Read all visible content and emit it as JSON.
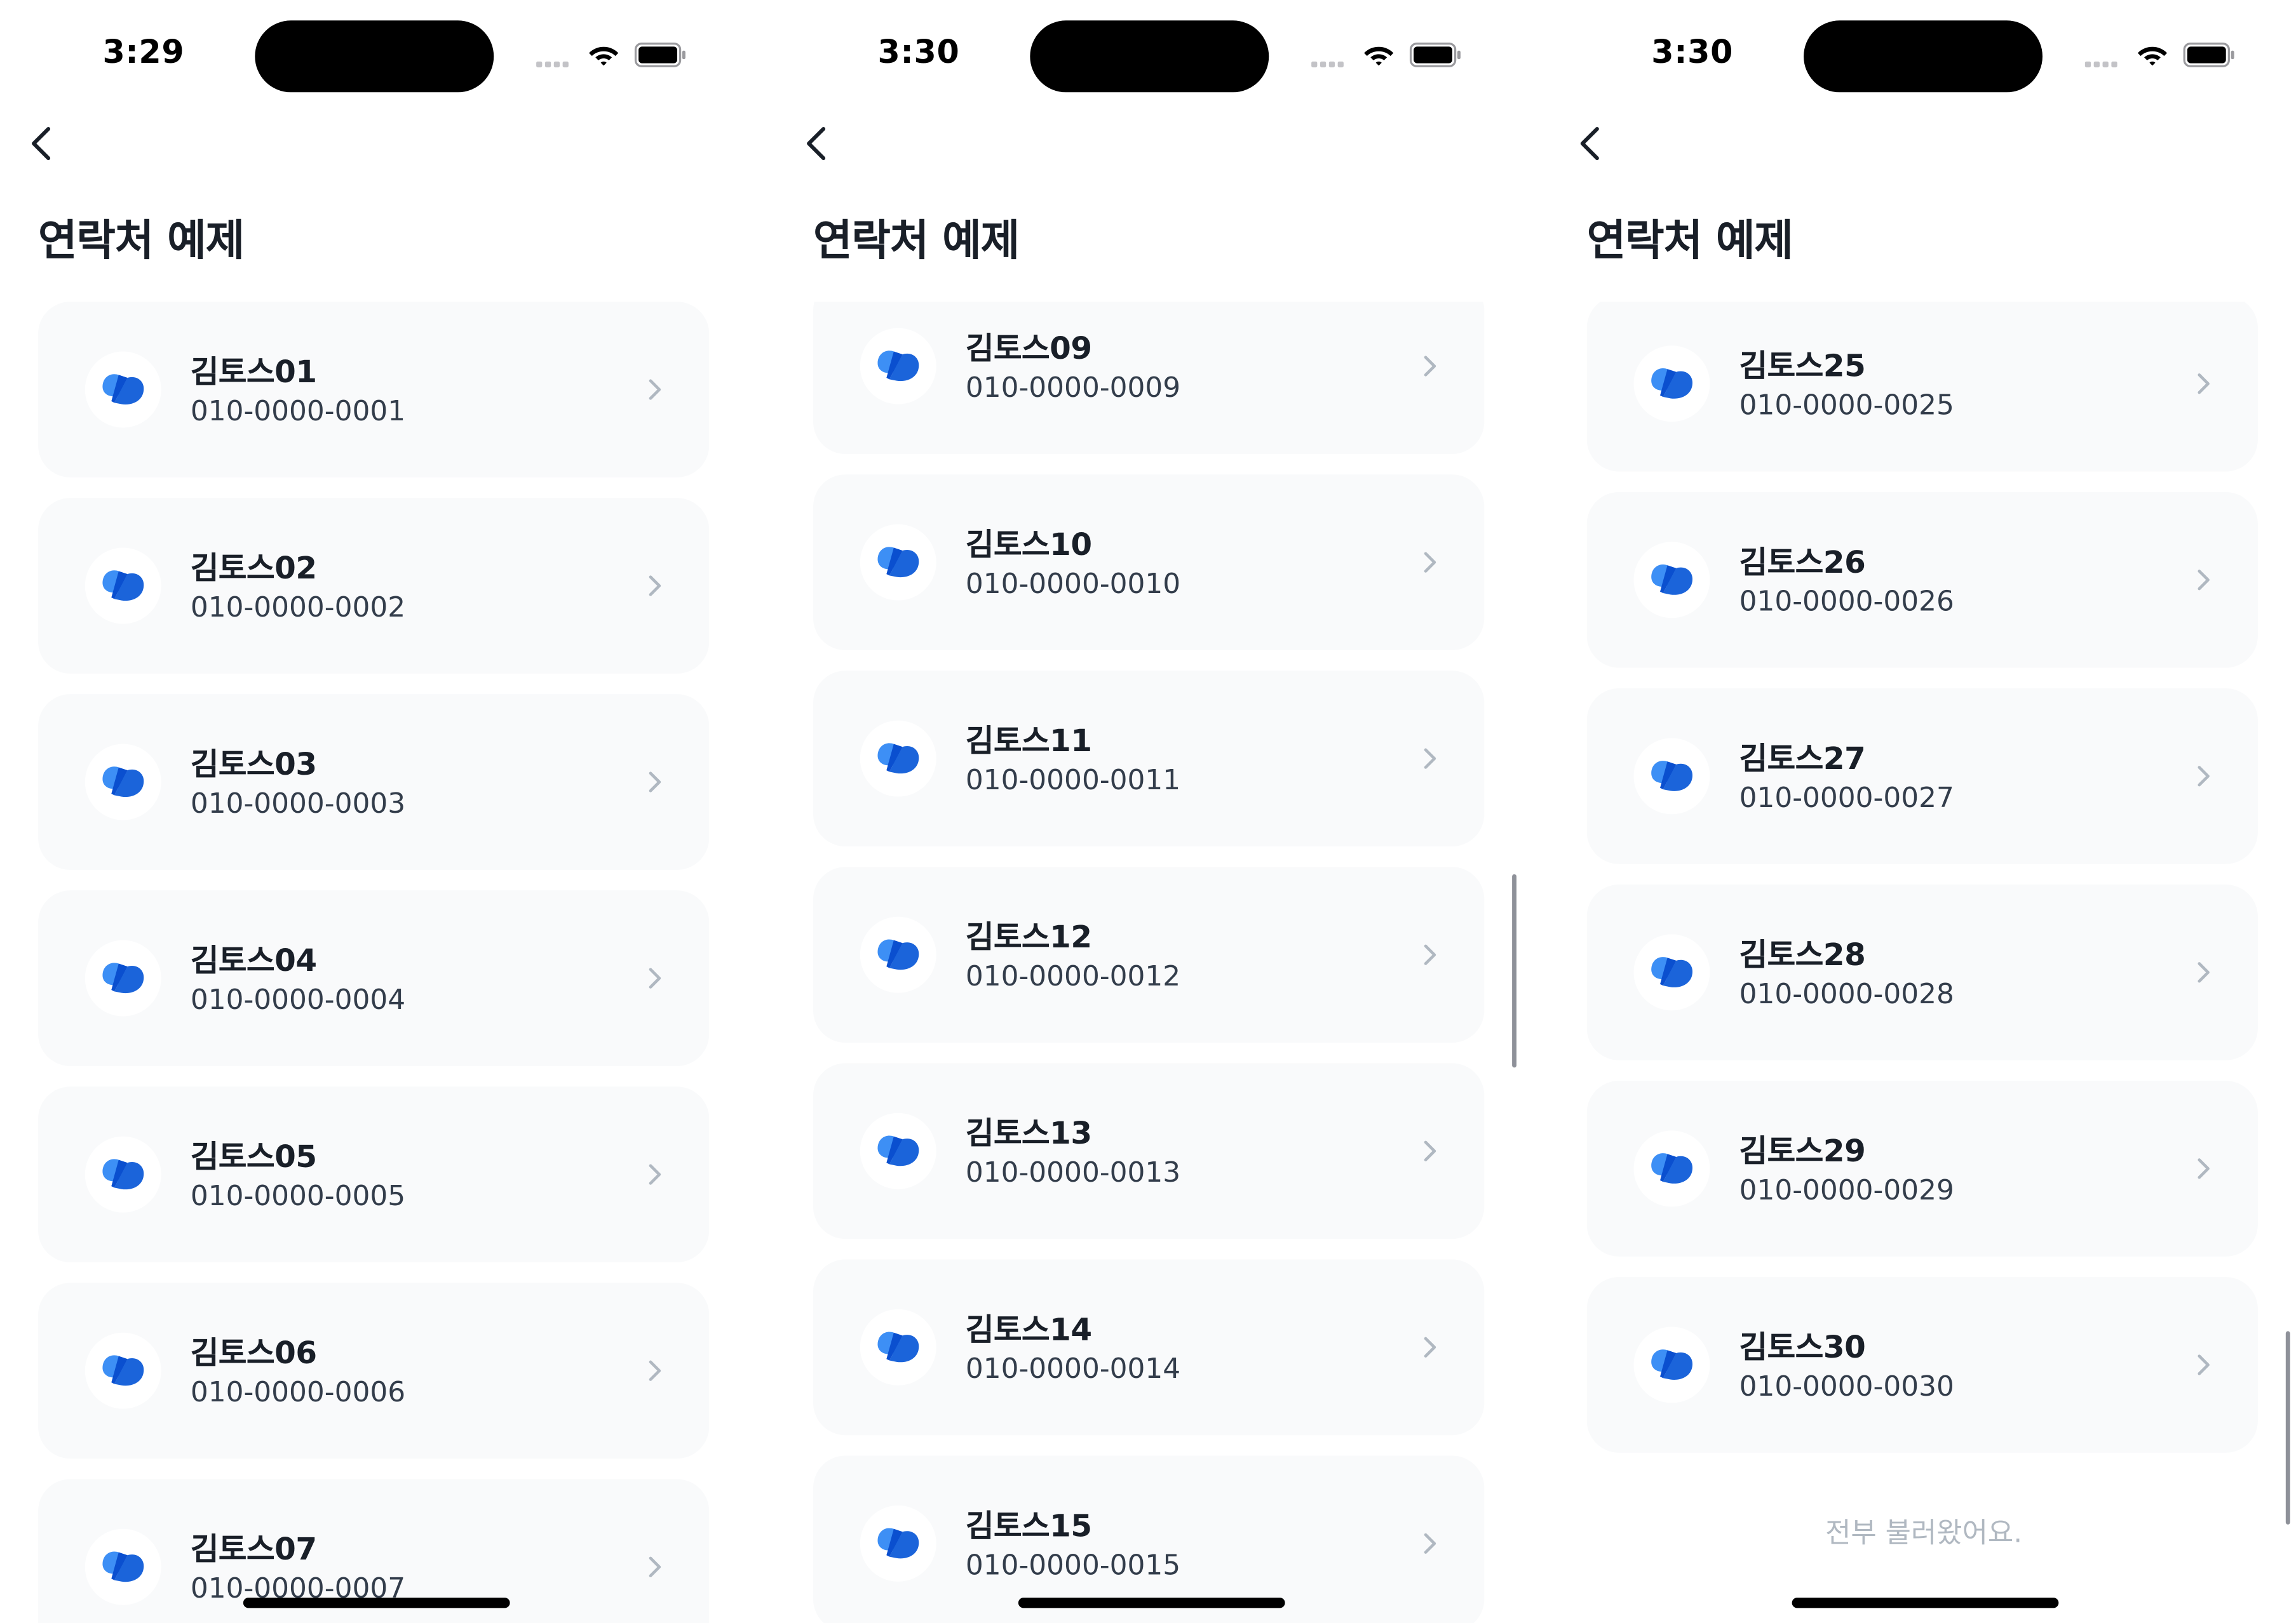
{
  "colors": {
    "background": "#ffffff",
    "card": "#f9fafb",
    "title_text": "#191f28",
    "phone_text": "#333d4b",
    "muted_text": "#b0b8c1",
    "chevron": "#b0b8c1",
    "logo_blue": "#3182f6"
  },
  "icons": {
    "back": "chevron-left-icon",
    "row_chevron": "chevron-right-icon",
    "avatar": "toss-logo-icon",
    "wifi": "wifi-icon",
    "battery": "battery-icon"
  },
  "screens": [
    {
      "status": {
        "time": "3:29"
      },
      "title": "연락처 예제",
      "contacts": [
        {
          "name": "김토스01",
          "phone": "010-0000-0001"
        },
        {
          "name": "김토스02",
          "phone": "010-0000-0002"
        },
        {
          "name": "김토스03",
          "phone": "010-0000-0003"
        },
        {
          "name": "김토스04",
          "phone": "010-0000-0004"
        },
        {
          "name": "김토스05",
          "phone": "010-0000-0005"
        },
        {
          "name": "김토스06",
          "phone": "010-0000-0006"
        },
        {
          "name": "김토스07",
          "phone": "010-0000-0007"
        }
      ],
      "end_message": ""
    },
    {
      "status": {
        "time": "3:30"
      },
      "title": "연락처 예제",
      "contacts": [
        {
          "name": "김토스09",
          "phone": "010-0000-0009"
        },
        {
          "name": "김토스10",
          "phone": "010-0000-0010"
        },
        {
          "name": "김토스11",
          "phone": "010-0000-0011"
        },
        {
          "name": "김토스12",
          "phone": "010-0000-0012"
        },
        {
          "name": "김토스13",
          "phone": "010-0000-0013"
        },
        {
          "name": "김토스14",
          "phone": "010-0000-0014"
        },
        {
          "name": "김토스15",
          "phone": "010-0000-0015"
        }
      ],
      "end_message": ""
    },
    {
      "status": {
        "time": "3:30"
      },
      "title": "연락처 예제",
      "contacts": [
        {
          "name": "김토스25",
          "phone": "010-0000-0025"
        },
        {
          "name": "김토스26",
          "phone": "010-0000-0026"
        },
        {
          "name": "김토스27",
          "phone": "010-0000-0027"
        },
        {
          "name": "김토스28",
          "phone": "010-0000-0028"
        },
        {
          "name": "김토스29",
          "phone": "010-0000-0029"
        },
        {
          "name": "김토스30",
          "phone": "010-0000-0030"
        }
      ],
      "end_message": "전부 불러왔어요."
    }
  ]
}
